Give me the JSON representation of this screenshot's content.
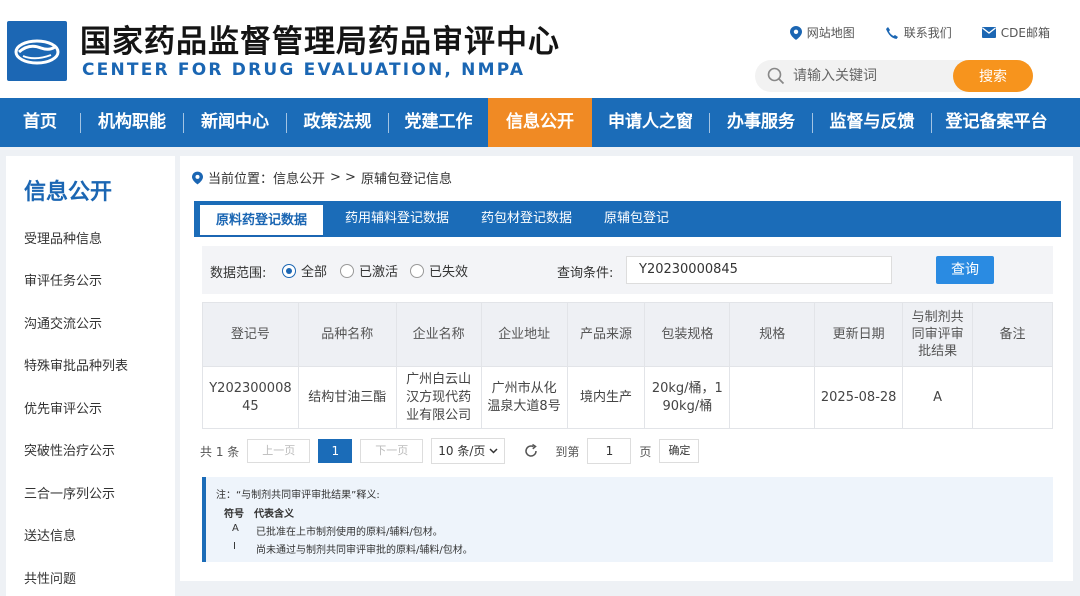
{
  "header": {
    "title": "国家药品监督管理局药品审评中心",
    "subtitle": "CENTER FOR DRUG EVALUATION, NMPA",
    "links": [
      "网站地图",
      "联系我们",
      "CDE邮箱"
    ],
    "search_placeholder": "请输入关键词",
    "search_button": "搜索"
  },
  "nav": {
    "items": [
      "首页",
      "机构职能",
      "新闻中心",
      "政策法规",
      "党建工作",
      "信息公开",
      "申请人之窗",
      "办事服务",
      "监督与反馈",
      "登记备案平台"
    ],
    "active": "信息公开"
  },
  "sidebar": {
    "title": "信息公开",
    "items": [
      "受理品种信息",
      "审评任务公示",
      "沟通交流公示",
      "特殊审批品种列表",
      "优先审评公示",
      "突破性治疗公示",
      "三合一序列公示",
      "送达信息",
      "共性问题"
    ]
  },
  "breadcrumb": {
    "prefix": "当前位置：信息公开",
    "sep": "> >",
    "current": "原辅包登记信息"
  },
  "tabs": [
    "原料药登记数据",
    "药用辅料登记数据",
    "药包材登记数据",
    "原辅包登记"
  ],
  "filter": {
    "scope_label": "数据范围:",
    "options": [
      "全部",
      "已激活",
      "已失效"
    ],
    "selected": "全部",
    "query_label": "查询条件:",
    "query_value": "Y20230000845",
    "query_button": "查询"
  },
  "table": {
    "headers": [
      "登记号",
      "品种名称",
      "企业名称",
      "企业地址",
      "产品来源",
      "包装规格",
      "规格",
      "更新日期",
      "与制剂共同审评审批结果",
      "备注"
    ],
    "rows": [
      [
        "Y20230000845",
        "结构甘油三酯",
        "广州白云山汉方现代药业有限公司",
        "广州市从化温泉大道8号",
        "境内生产",
        "20kg/桶，190kg/桶",
        "",
        "2025-08-28",
        "A",
        ""
      ]
    ]
  },
  "pager": {
    "total": "共 1 条",
    "prev": "上一页",
    "page": "1",
    "next": "下一页",
    "size": "10 条/页",
    "goto_label": "到第",
    "goto_value": "1",
    "page_unit": "页",
    "confirm": "确定"
  },
  "note": {
    "title": "注：“与制剂共同审评审批结果”释义:",
    "header_symbol": "符号",
    "header_meaning": "代表含义",
    "rows": [
      {
        "symbol": "A",
        "meaning": "已批准在上市制剂使用的原料/辅料/包材。"
      },
      {
        "symbol": "I",
        "meaning": "尚未通过与制剂共同审评审批的原料/辅料/包材。"
      }
    ]
  },
  "colors": {
    "brand_blue": "#1b6cb8",
    "accent_orange": "#f08a24"
  }
}
